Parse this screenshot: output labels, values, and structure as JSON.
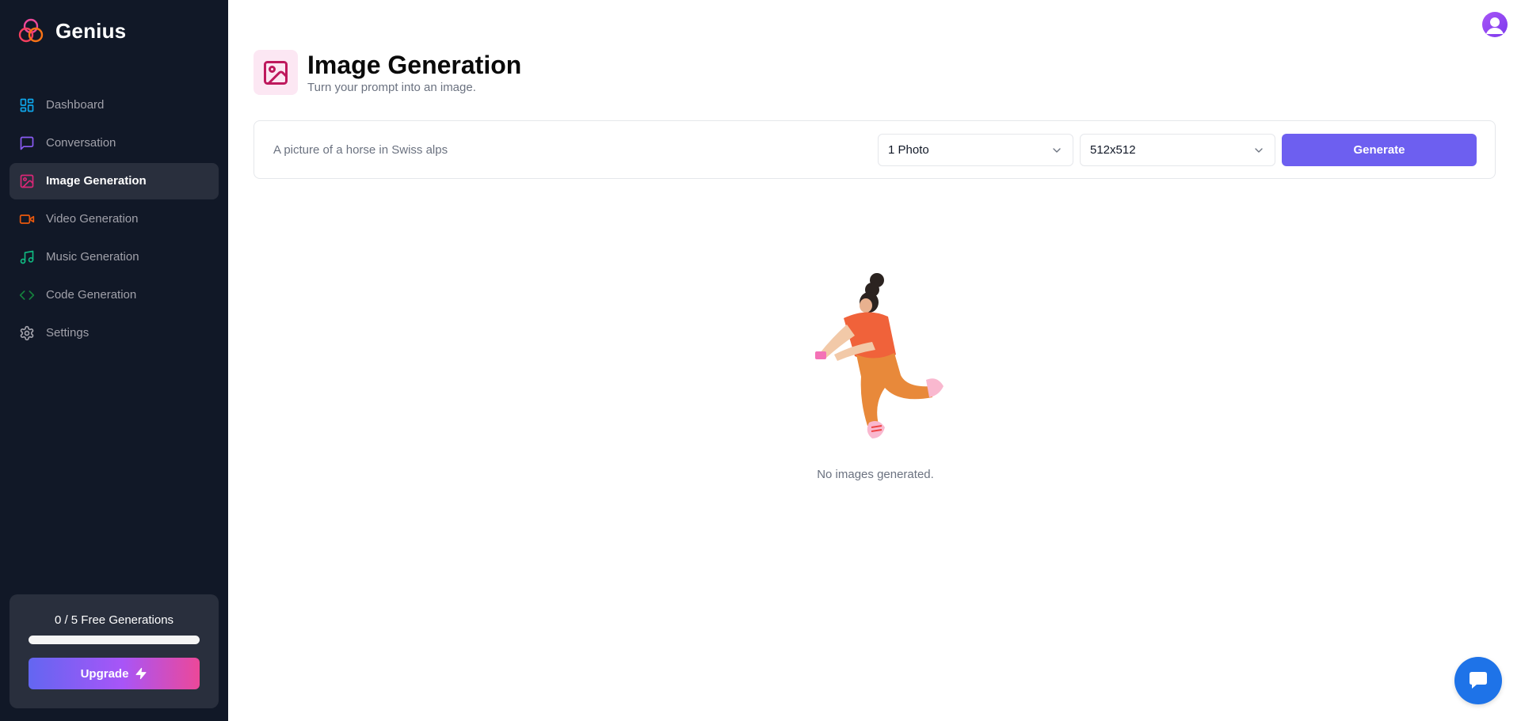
{
  "brand": {
    "name": "Genius"
  },
  "sidebar": {
    "items": [
      {
        "label": "Dashboard",
        "icon": "layout-dashboard-icon",
        "color": "#0ea5e9",
        "active": false
      },
      {
        "label": "Conversation",
        "icon": "message-square-icon",
        "color": "#8b5cf6",
        "active": false
      },
      {
        "label": "Image Generation",
        "icon": "image-icon",
        "color": "#db2777",
        "active": true
      },
      {
        "label": "Video Generation",
        "icon": "video-icon",
        "color": "#ea580c",
        "active": false
      },
      {
        "label": "Music Generation",
        "icon": "music-icon",
        "color": "#10b981",
        "active": false
      },
      {
        "label": "Code Generation",
        "icon": "code-icon",
        "color": "#15803d",
        "active": false
      },
      {
        "label": "Settings",
        "icon": "settings-icon",
        "color": "#a1a1aa",
        "active": false
      }
    ],
    "free_counter": {
      "text": "0 / 5 Free Generations",
      "used": 0,
      "limit": 5,
      "progress_percent": 0
    },
    "upgrade_label": "Upgrade"
  },
  "header": {
    "title": "Image Generation",
    "subtitle": "Turn your prompt into an image.",
    "icon": "image-icon",
    "icon_color": "#be185d",
    "icon_bg": "#fce7f3"
  },
  "form": {
    "prompt_placeholder": "A picture of a horse in Swiss alps",
    "prompt_value": "",
    "amount_selected": "1 Photo",
    "resolution_selected": "512x512",
    "generate_label": "Generate"
  },
  "empty_state": {
    "text": "No images generated."
  },
  "colors": {
    "sidebar_bg": "#111827",
    "accent": "#6d5ff0",
    "chat_launcher": "#1e73e8"
  }
}
